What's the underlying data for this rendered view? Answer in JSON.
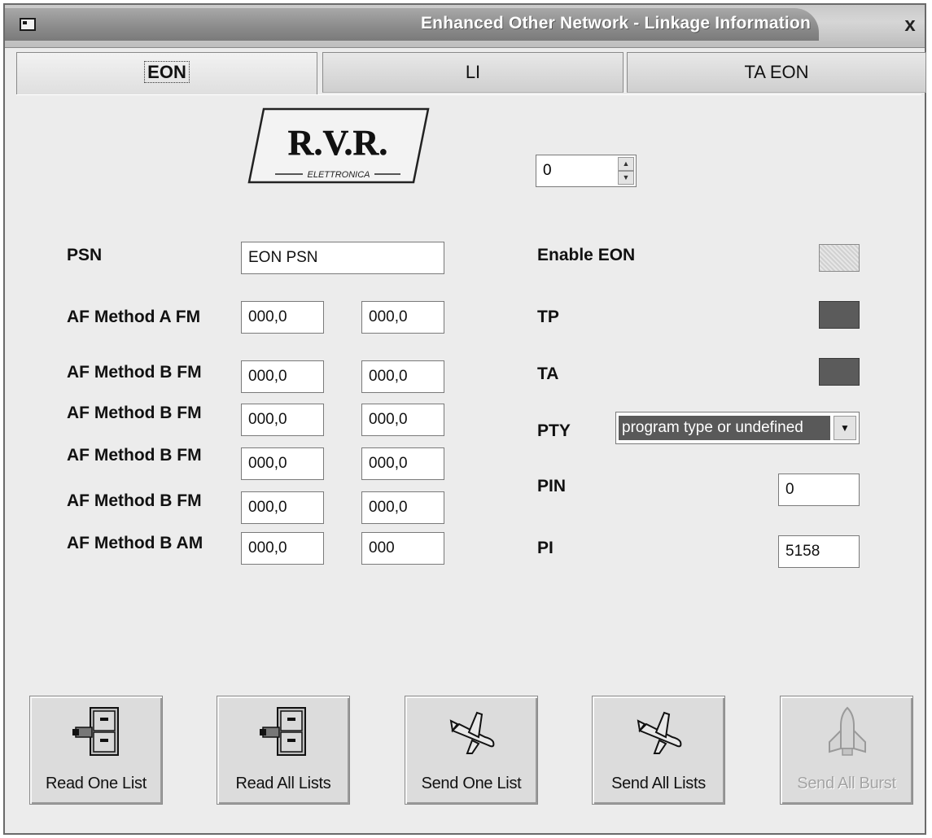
{
  "window": {
    "title": "Enhanced Other Network - Linkage Information",
    "close_label": "x"
  },
  "tabs": [
    {
      "label": "EON",
      "active": true
    },
    {
      "label": "LI",
      "active": false
    },
    {
      "label": "TA EON",
      "active": false
    }
  ],
  "logo": {
    "text": "R.V.R.",
    "subtitle": "ELETTRONICA"
  },
  "spinner": {
    "value": "0"
  },
  "left_fields": {
    "psn": {
      "label": "PSN",
      "value": "EON PSN"
    },
    "rows": [
      {
        "label": "AF Method A FM",
        "value1": "000,0",
        "value2": "000,0"
      },
      {
        "label": "AF Method B FM",
        "value1": "000,0",
        "value2": "000,0"
      },
      {
        "label": "AF Method B FM",
        "value1": "000,0",
        "value2": "000,0"
      },
      {
        "label": "AF Method B FM",
        "value1": "000,0",
        "value2": "000,0"
      },
      {
        "label": "AF Method B FM",
        "value1": "000,0",
        "value2": "000,0"
      },
      {
        "label": "AF Method B AM",
        "value1": "000,0",
        "value2": "000"
      }
    ]
  },
  "right_fields": {
    "enable_eon": {
      "label": "Enable EON",
      "checked": false
    },
    "tp": {
      "label": "TP",
      "checked": true
    },
    "ta": {
      "label": "TA",
      "checked": true
    },
    "pty": {
      "label": "PTY",
      "selected": "program type or undefined"
    },
    "pin": {
      "label": "PIN",
      "value": "0"
    },
    "pi": {
      "label": "PI",
      "value": "5158"
    }
  },
  "buttons": [
    {
      "label": "Read One List",
      "icon": "file-cabinet-icon",
      "enabled": true
    },
    {
      "label": "Read All Lists",
      "icon": "file-cabinet-icon",
      "enabled": true
    },
    {
      "label": "Send One List",
      "icon": "airplane-icon",
      "enabled": true
    },
    {
      "label": "Send All Lists",
      "icon": "airplane-icon",
      "enabled": true
    },
    {
      "label": "Send All Burst",
      "icon": "space-shuttle-icon",
      "enabled": false
    }
  ],
  "colors": {
    "title_bar": "#8d8d8d",
    "panel": "#ececec",
    "checked_fill": "#5b5b5b",
    "disabled_text": "#a4a4a4"
  }
}
